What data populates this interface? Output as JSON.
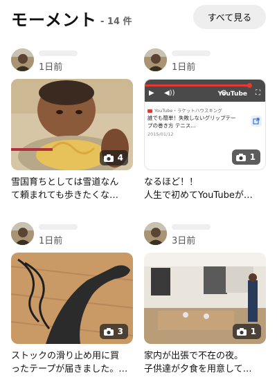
{
  "header": {
    "title": "モーメント",
    "count": "- 14 件",
    "see_all": "すべて見る"
  },
  "colors": {
    "accent_youtube": "#e53935",
    "badge_bg": "#1e1e1e",
    "button_bg": "#eeeeee"
  },
  "moments": [
    {
      "date": "1日前",
      "photo_count": "4",
      "caption": [
        "雪国育ちとしては雪道なん",
        "て頼まれても歩きたくな…"
      ],
      "photo_icon": "camera-icon"
    },
    {
      "date": "1日前",
      "photo_count": "1",
      "caption": [
        "なるほど！！",
        "人生で初めてYouTubeが…"
      ],
      "photo_icon": "camera-icon",
      "youtube": {
        "logo": "YouTube",
        "source": "YouTube・ラケットハウスキング",
        "title": [
          "誰でも簡単！失敗しないグリップテー",
          "プの巻き方 テニス..."
        ],
        "date": "2015/01/12"
      }
    },
    {
      "date": "1日前",
      "photo_count": "3",
      "caption": [
        "ストックの滑り止め用に買",
        "ったテープが届きました。…"
      ],
      "photo_icon": "camera-icon"
    },
    {
      "date": "3日前",
      "photo_count": "1",
      "caption": [
        "家内が出張で不在の夜。",
        "子供達が夕食を用意して…"
      ],
      "photo_icon": "camera-icon"
    }
  ]
}
